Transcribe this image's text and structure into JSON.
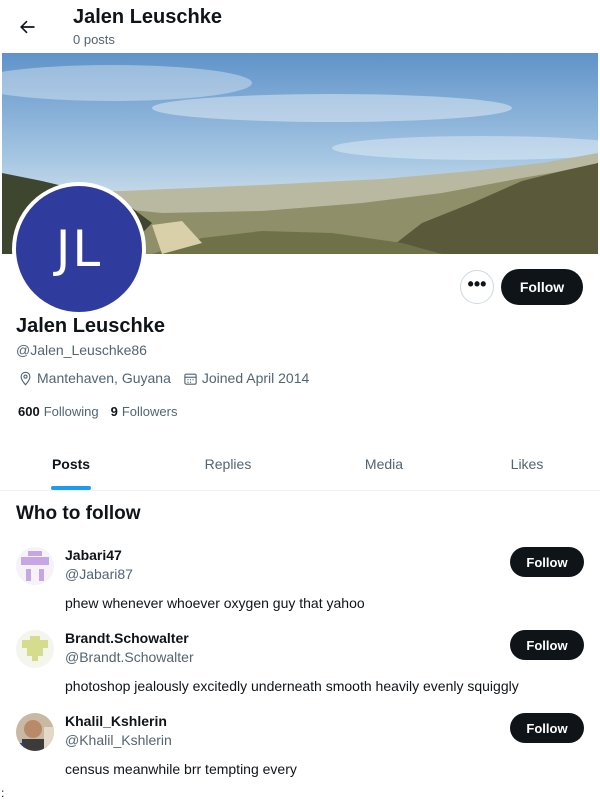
{
  "header": {
    "title": "Jalen Leuschke",
    "subtitle": "0 posts",
    "back_icon": "arrow-left-icon"
  },
  "profile": {
    "avatar_initials": "JL",
    "avatar_color": "#2f3c9e",
    "name": "Jalen Leuschke",
    "handle": "@Jalen_Leuschke86",
    "location": "Mantehaven, Guyana",
    "joined": "Joined April 2014",
    "following_count": "600",
    "following_label": "Following",
    "followers_count": "9",
    "followers_label": "Followers",
    "follow_label": "Follow",
    "more_label": "•••"
  },
  "tabs": [
    {
      "label": "Posts",
      "active": true
    },
    {
      "label": "Replies",
      "active": false
    },
    {
      "label": "Media",
      "active": false
    },
    {
      "label": "Likes",
      "active": false
    }
  ],
  "who_to_follow": {
    "title": "Who to follow",
    "users": [
      {
        "name": "Jabari47",
        "handle": "@Jabari87",
        "bio": "phew whenever whoever oxygen guy that yahoo",
        "follow_label": "Follow"
      },
      {
        "name": "Brandt.Schowalter",
        "handle": "@Brandt.Schowalter",
        "bio": "photoshop jealously excitedly underneath smooth heavily evenly squiggly",
        "follow_label": "Follow"
      },
      {
        "name": "Khalil_Kshlerin",
        "handle": "@Khalil_Kshlerin",
        "bio": "census meanwhile brr tempting every",
        "follow_label": "Follow"
      }
    ]
  },
  "stray_text": ":",
  "colors": {
    "accent": "#1d9bf0",
    "button_dark": "#0f1419",
    "secondary_text": "#536471"
  }
}
